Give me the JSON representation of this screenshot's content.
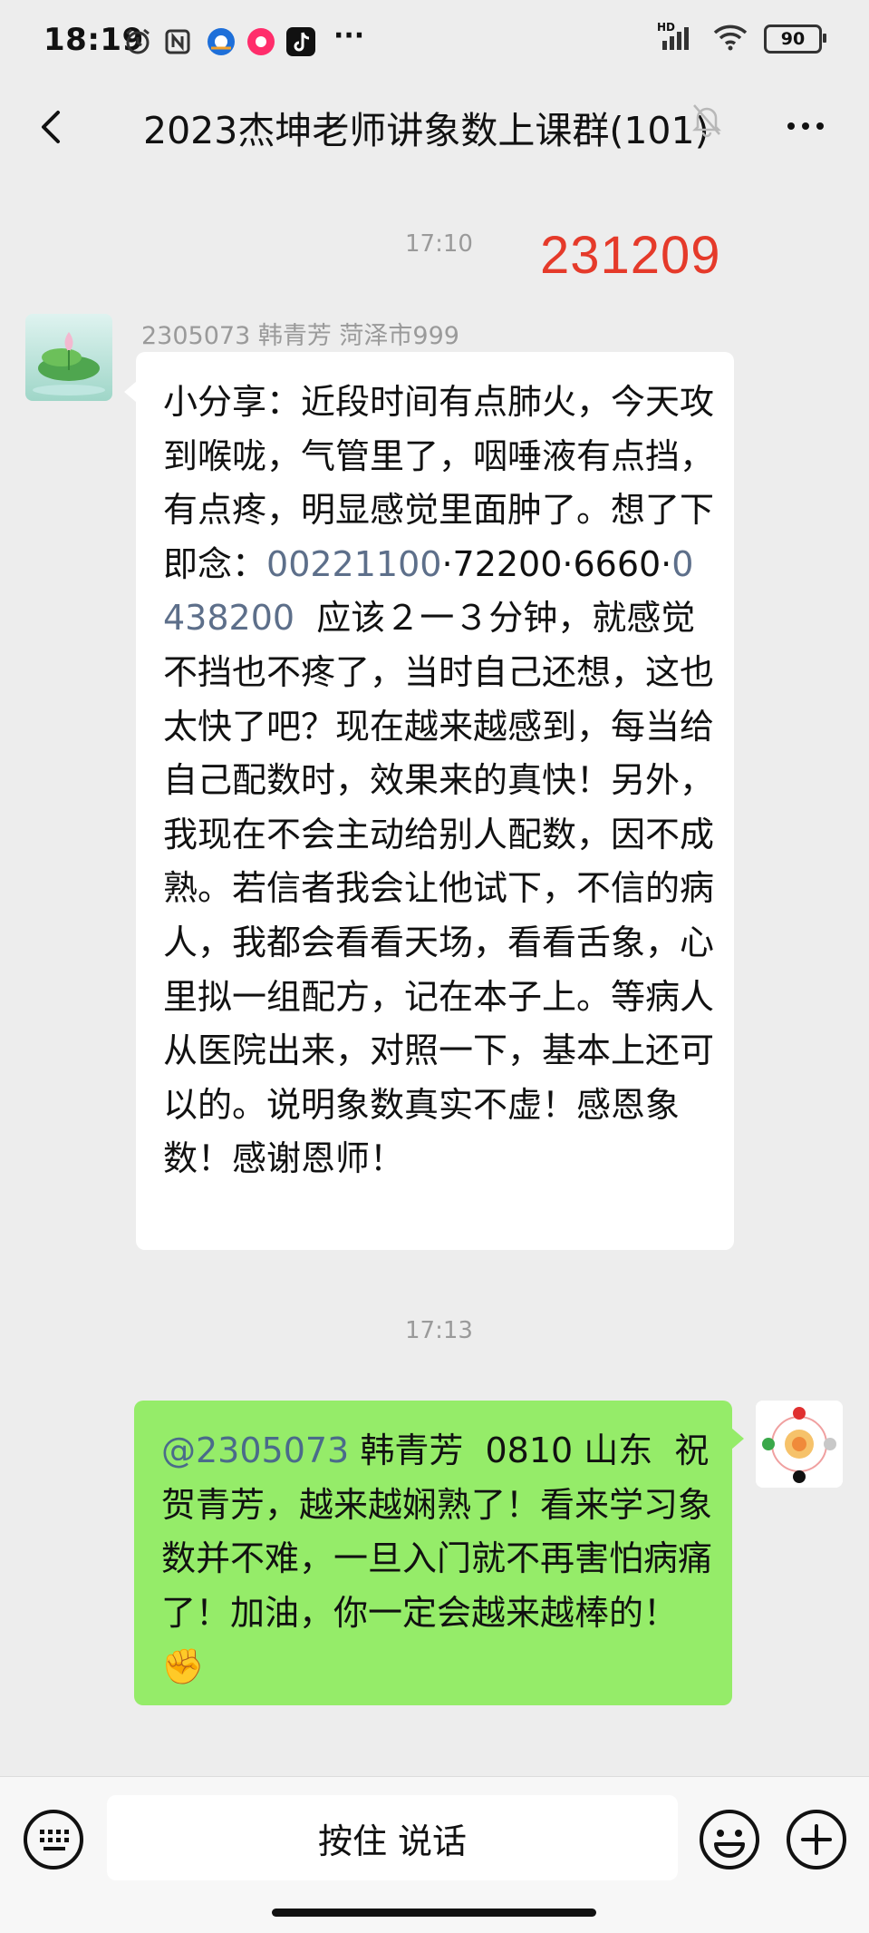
{
  "status_bar": {
    "time": "18:19",
    "network": "HD",
    "battery": "90",
    "overflow": "···"
  },
  "header": {
    "title": "2023杰坤老师讲象数上课群(101)",
    "back_icon": "chevron-left-icon",
    "mute_icon": "bell-off-icon",
    "more_icon": "more-icon"
  },
  "messages": [
    {
      "timestamp": "17:10",
      "stamp": "231209",
      "sender": "2305073   韩青芳   菏泽市999",
      "text_before_1": "小分享：近段时间有点肺火，今天攻到喉咙，气管里了，咽唾液有点挡，有点疼，明显感觉里面肿了。想了下即念：",
      "num_1": "00221100",
      "text_mid": "·72200·6660·",
      "num_2": "0438200",
      "text_after": "  应该２一３分钟，就感觉不挡也不疼了，当时自己还想，这也太快了吧？现在越来越感到，每当给自己配数时，效果来的真快！另外，我现在不会主动给别人配数，因不成熟。若信者我会让他试下，不信的病人，我都会看看天场，看看舌象，心里拟一组配方，记在本子上。等病人从医院出来，对照一下，基本上还可以的。说明象数真实不虚！感恩象数！感谢恩师！"
    },
    {
      "timestamp": "17:13",
      "mention": "@2305073",
      "text": " 韩青芳  0810 山东  祝贺青芳，越来越娴熟了！看来学习象数并不难，一旦入门就不再害怕病痛了！加油，你一定会越来越棒的！",
      "emoji": "✊"
    }
  ],
  "input_bar": {
    "voice_label": "按住 说话",
    "keyboard_icon": "keyboard-icon",
    "emoji_icon": "smiley-icon",
    "plus_icon": "plus-icon"
  },
  "colors": {
    "background": "#ededed",
    "own_bubble": "#95ec69",
    "stamp": "#e53a2a"
  }
}
